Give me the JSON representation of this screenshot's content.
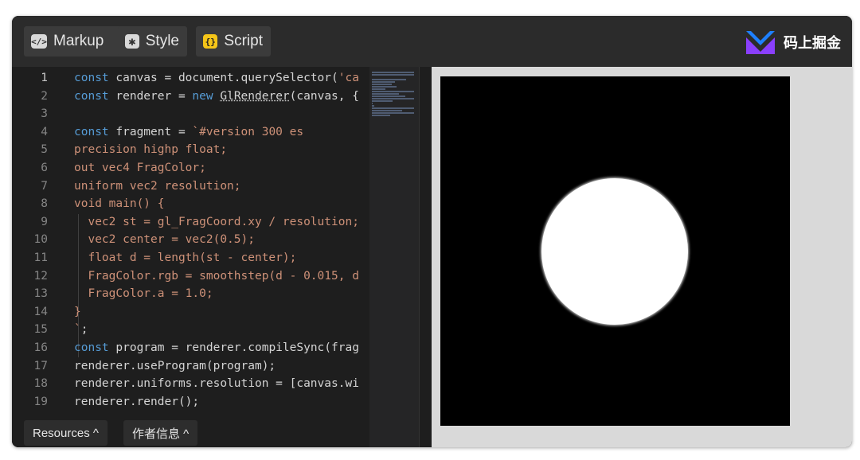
{
  "toolbar": {
    "tabs": [
      {
        "label": "Markup",
        "icon": "code-tag-icon"
      },
      {
        "label": "Style",
        "icon": "asterisk-icon"
      },
      {
        "label": "Script",
        "icon": "braces-icon"
      }
    ],
    "brand": "码上掘金"
  },
  "editor": {
    "line_numbers": [
      "1",
      "2",
      "3",
      "4",
      "5",
      "6",
      "7",
      "8",
      "9",
      "10",
      "11",
      "12",
      "13",
      "14",
      "15",
      "16",
      "17",
      "18",
      "19"
    ],
    "lines": [
      [
        {
          "t": "const",
          "c": "kw"
        },
        {
          "t": " canvas = document.querySelector(",
          "c": ""
        },
        {
          "t": "'ca",
          "c": "str"
        }
      ],
      [
        {
          "t": "const",
          "c": "kw"
        },
        {
          "t": " renderer = ",
          "c": ""
        },
        {
          "t": "new",
          "c": "kw"
        },
        {
          "t": " ",
          "c": ""
        },
        {
          "t": "GlRenderer",
          "c": "squig"
        },
        {
          "t": "(canvas, {",
          "c": ""
        }
      ],
      [],
      [
        {
          "t": "const",
          "c": "kw"
        },
        {
          "t": " fragment = ",
          "c": ""
        },
        {
          "t": "`#version 300 es",
          "c": "str"
        }
      ],
      [
        {
          "t": "precision highp float;",
          "c": "str"
        }
      ],
      [
        {
          "t": "out vec4 FragColor;",
          "c": "str"
        }
      ],
      [
        {
          "t": "uniform vec2 resolution;",
          "c": "str"
        }
      ],
      [
        {
          "t": "void main() {",
          "c": "str"
        }
      ],
      [
        {
          "t": "  vec2 st = gl_FragCoord.xy / resolution;",
          "c": "str"
        }
      ],
      [
        {
          "t": "  vec2 center = vec2(0.5);",
          "c": "str"
        }
      ],
      [
        {
          "t": "  float d = length(st - center);",
          "c": "str"
        }
      ],
      [
        {
          "t": "  FragColor.rgb = smoothstep(d - 0.015, d",
          "c": "str"
        }
      ],
      [
        {
          "t": "  FragColor.a = 1.0;",
          "c": "str"
        }
      ],
      [
        {
          "t": "}",
          "c": "str"
        }
      ],
      [
        {
          "t": "`",
          "c": "str"
        },
        {
          "t": ";",
          "c": ""
        }
      ],
      [
        {
          "t": "const",
          "c": "kw"
        },
        {
          "t": " program = renderer.compileSync(frag",
          "c": ""
        }
      ],
      [
        {
          "t": "renderer.useProgram(program);",
          "c": ""
        }
      ],
      [
        {
          "t": "renderer.uniforms.resolution = [canvas.wi",
          "c": ""
        }
      ],
      [
        {
          "t": "renderer.render();",
          "c": ""
        }
      ]
    ]
  },
  "footer": {
    "resources_label": "Resources ^",
    "author_label": "作者信息 ^"
  },
  "colors": {
    "keyword": "#569cd6",
    "string": "#ce9178",
    "script_icon": "#f5c518",
    "brand_blue": "#1e80ff",
    "brand_purple": "#8a3ffc"
  }
}
